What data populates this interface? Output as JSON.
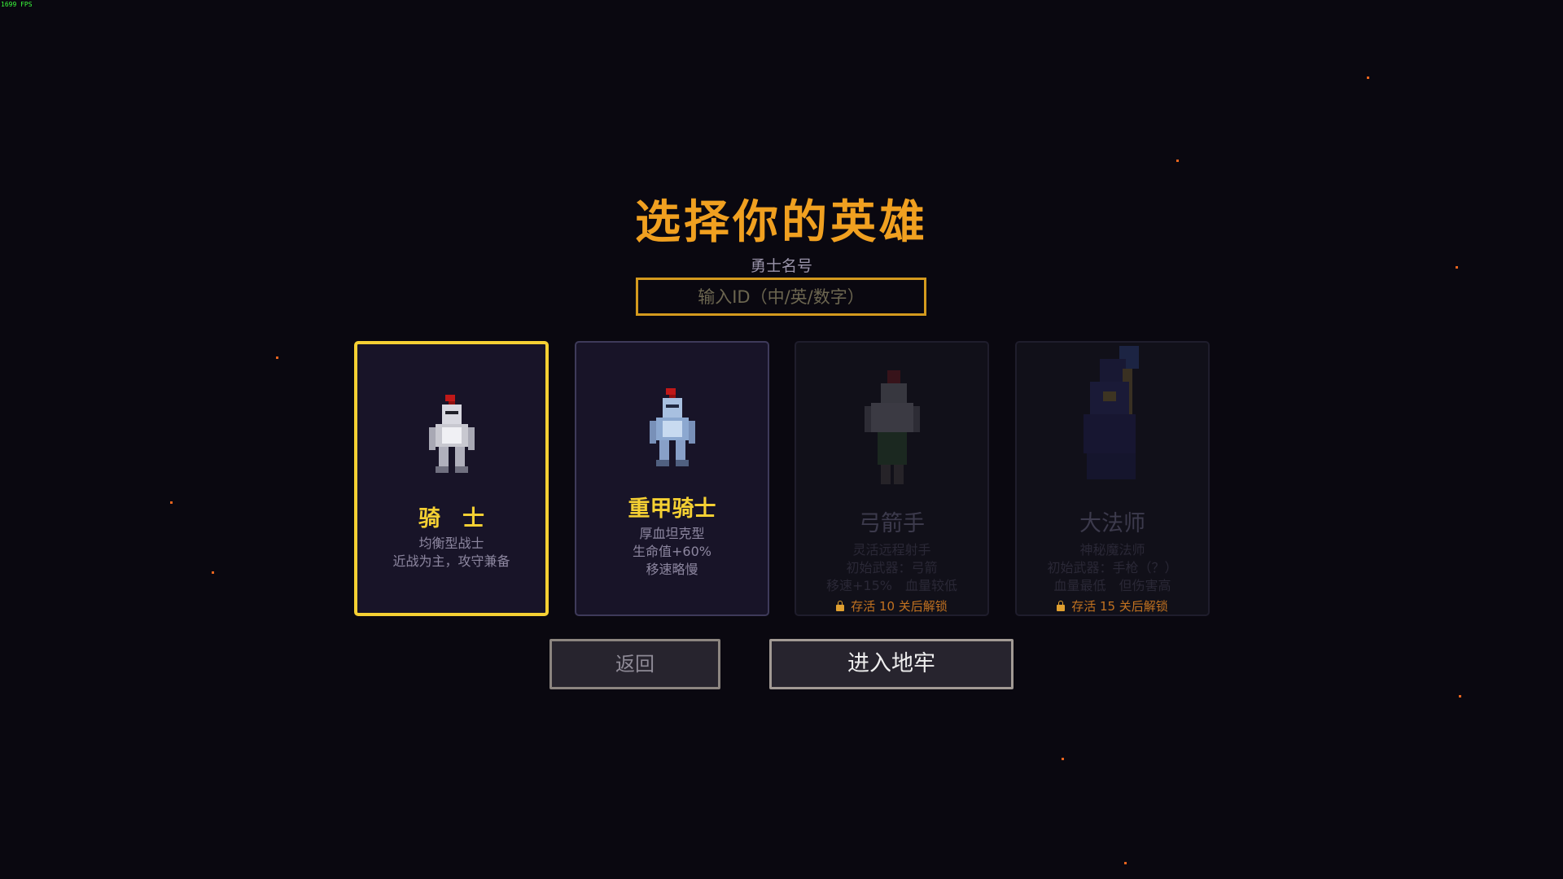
{
  "fps": "1699 FPS",
  "title": "选择你的英雄",
  "name_field": {
    "label": "勇士名号",
    "placeholder": "输入ID（中/英/数字）",
    "value": ""
  },
  "heroes": [
    {
      "name": "骑　士",
      "lines": [
        "均衡型战士",
        "近战为主，攻守兼备"
      ],
      "state": "selected"
    },
    {
      "name": "重甲骑士",
      "lines": [
        "厚血坦克型",
        "生命值+60%",
        "移速略慢"
      ],
      "state": "available"
    },
    {
      "name": "弓箭手",
      "lines": [
        "灵活远程射手",
        "初始武器：弓箭",
        "移速+15%　血量较低"
      ],
      "state": "locked",
      "unlock": "存活 10 关后解锁"
    },
    {
      "name": "大法师",
      "lines": [
        "神秘魔法师",
        "初始武器：手枪（？）",
        "血量最低　但伤害高"
      ],
      "state": "locked",
      "unlock": "存活 15 关后解锁"
    }
  ],
  "buttons": {
    "back": "返回",
    "enter": "进入地牢"
  },
  "colors": {
    "title": "#f0a020",
    "selected_border": "#f5d033",
    "hero_name": "#f5d033",
    "unlock_text": "#c27220",
    "background": "#0a0810"
  },
  "icons": [
    "knight-sprite",
    "heavy-knight-sprite",
    "archer-sprite",
    "archmage-sprite",
    "lock-icon"
  ]
}
